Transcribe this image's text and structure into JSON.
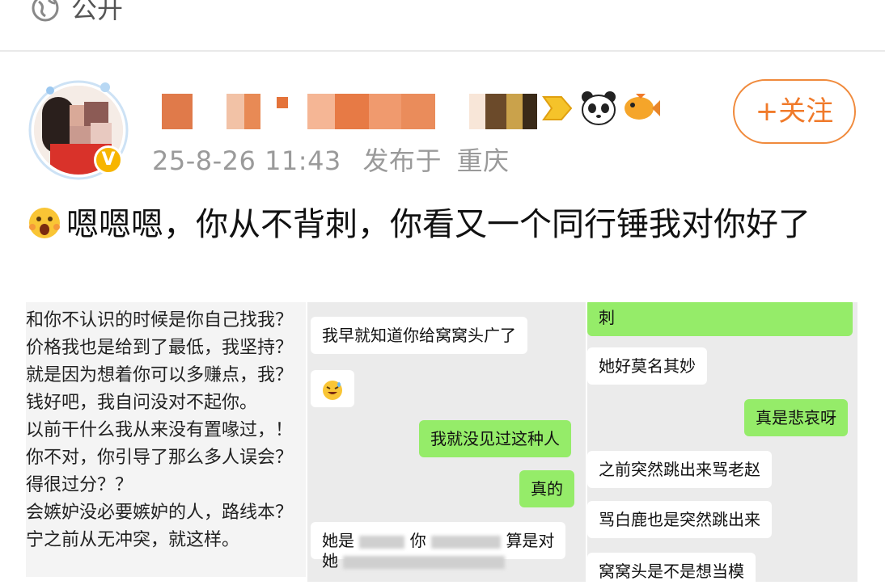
{
  "header": {
    "visibility_label": "公开",
    "globe_icon": "globe-icon"
  },
  "post": {
    "author_avatar": "avatar",
    "verified_badge": "V",
    "timestamp": "25-8-26 11:43",
    "location_prefix": "发布于",
    "location": "重庆",
    "follow_label": "+关注",
    "text": "嗯嗯嗯，你从不背刺，你看又一个同行锤我对你好了",
    "emoji": "surprised-face-emoji"
  },
  "images": {
    "left": {
      "lines": [
        "和你不认识的时候是你自己找我？",
        "价格我也是给到了最低，我坚持？",
        "就是因为想着你可以多赚点，我？",
        "钱好吧，我自问没对不起你。",
        "以前干什么我从来没有置喙过，！",
        "你不对，你引导了那么多人误会？",
        "得很过分？？",
        "会嫉妒没必要嫉妒的人，路线本？",
        "宁之前从无冲突，就这样。"
      ]
    },
    "middle": {
      "messages": [
        {
          "text": "我早就知道你给窝窝头广了",
          "side": "left"
        },
        {
          "text": "😅",
          "side": "left"
        },
        {
          "text": "我就没见过这种人",
          "side": "right"
        },
        {
          "text": "真的",
          "side": "right"
        },
        {
          "text": "她是",
          "text2": "你",
          "text3": "算是对",
          "side": "left"
        },
        {
          "text": "她",
          "side": "left"
        }
      ]
    },
    "right": {
      "messages": [
        {
          "text": "刺",
          "side": "right"
        },
        {
          "text": "她好莫名其妙",
          "side": "left"
        },
        {
          "text": "真是悲哀呀",
          "side": "right"
        },
        {
          "text": "之前突然跳出来骂老赵",
          "side": "left"
        },
        {
          "text": "骂白鹿也是突然跳出来",
          "side": "left"
        },
        {
          "text": "窝窝头是不是想当模",
          "side": "left"
        }
      ]
    }
  },
  "colors": {
    "accent": "#f07a2a",
    "chat_green": "#95ec69",
    "meta_gray": "#9a9a9a"
  }
}
